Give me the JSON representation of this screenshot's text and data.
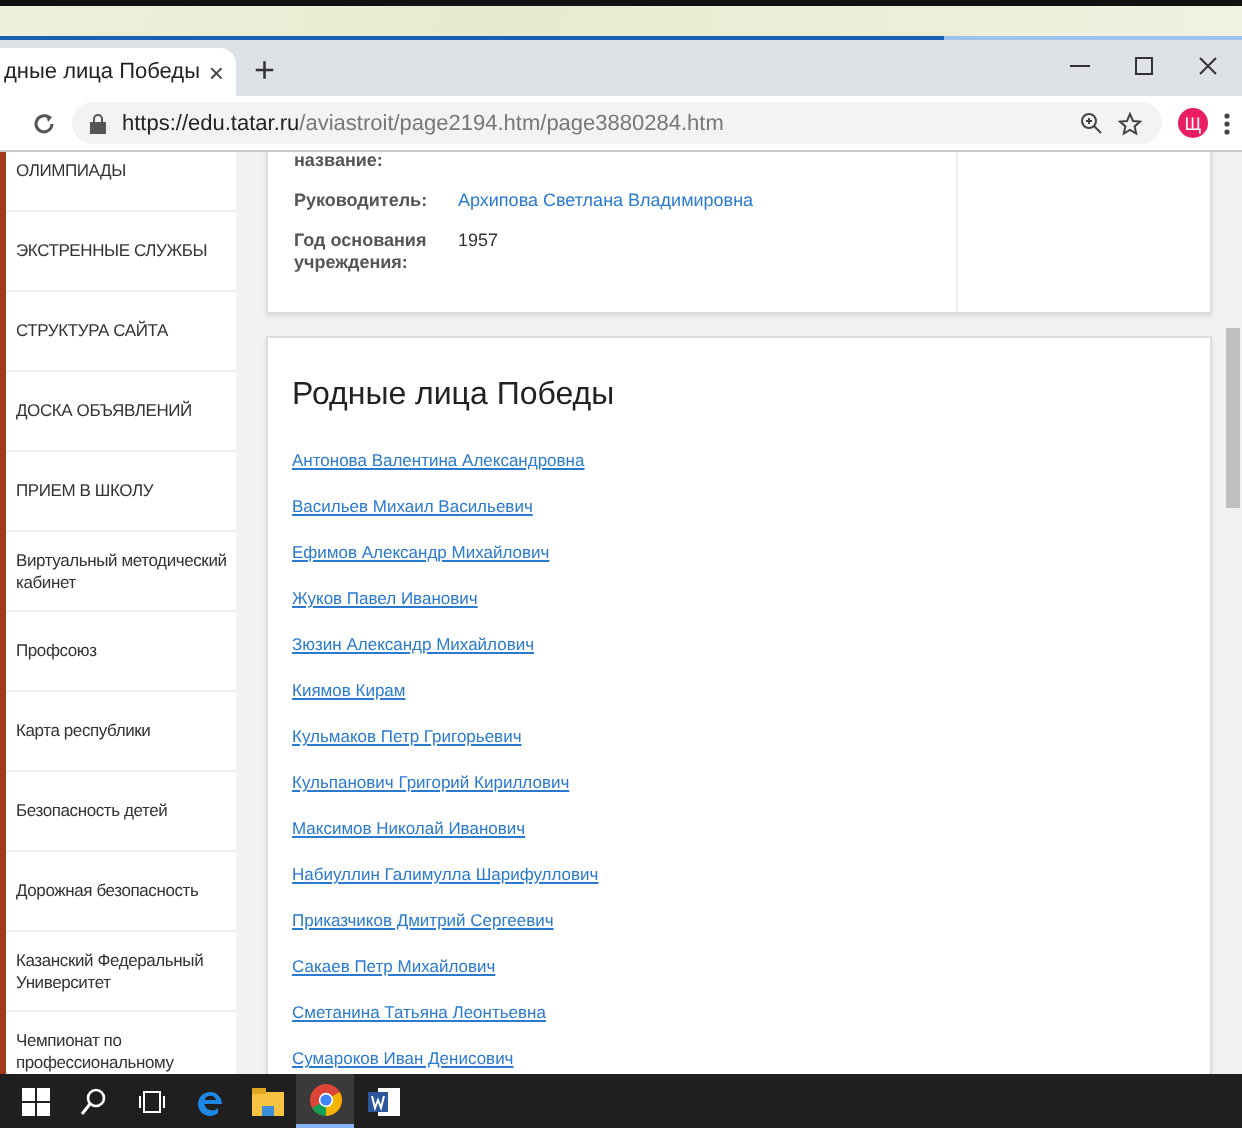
{
  "browser": {
    "tab": {
      "title": "дные лица Победы",
      "close": "×"
    },
    "new_tab": "+",
    "url": {
      "host": "https://edu.tatar.ru",
      "path": "/aviastroit/page2194.htm/page3880284.htm"
    },
    "profile_initial": "Щ"
  },
  "sidebar": {
    "items": [
      {
        "label": "ОЛИМПИАДЫ"
      },
      {
        "label": "ЭКСТРЕННЫЕ СЛУЖБЫ"
      },
      {
        "label": "СТРУКТУРА САЙТА"
      },
      {
        "label": "ДОСКА ОБЪЯВЛЕНИЙ"
      },
      {
        "label": "ПРИЕМ В ШКОЛУ"
      },
      {
        "label": "Виртуальный методический кабинет"
      },
      {
        "label": "Профсоюз"
      },
      {
        "label": "Карта республики"
      },
      {
        "label": "Безопасность детей"
      },
      {
        "label": "Дорожная безопасность"
      },
      {
        "label": "Казанский Федеральный Университет"
      },
      {
        "label": "Чемпионат по профессиональному"
      }
    ]
  },
  "info_card": {
    "rows": [
      {
        "label": "название:"
      },
      {
        "label": "Руководитель:",
        "value": "Архипова Светлана Владимировна",
        "kind": "link"
      },
      {
        "label": "Год основания учреждения:",
        "value": "1957",
        "kind": "text"
      }
    ]
  },
  "list_card": {
    "title": "Родные лица Победы",
    "people": [
      "Антонова Валентина Александровна",
      "Васильев Михаил Васильевич",
      "Ефимов Александр Михайлович",
      "Жуков Павел Иванович",
      "Зюзин Александр Михайлович",
      "Киямов Кирам",
      "Кульмаков Петр Григорьевич",
      "Кульпанович Григорий Кириллович",
      "Максимов Николай Иванович",
      "Набиуллин Галимулла Шарифуллович",
      "Приказчиков Дмитрий Сергеевич",
      "Сакаев Петр Михайлович",
      "Сметанина Татьяна Леонтьевна",
      "Сумароков Иван Денисович"
    ]
  },
  "taskbar": {
    "apps": [
      {
        "kind": "start",
        "selected": false
      },
      {
        "kind": "search",
        "selected": false
      },
      {
        "kind": "taskview",
        "selected": false
      },
      {
        "kind": "edge",
        "selected": false
      },
      {
        "kind": "folder",
        "selected": false
      },
      {
        "kind": "chrome",
        "selected": true
      },
      {
        "kind": "word",
        "selected": false
      }
    ]
  }
}
